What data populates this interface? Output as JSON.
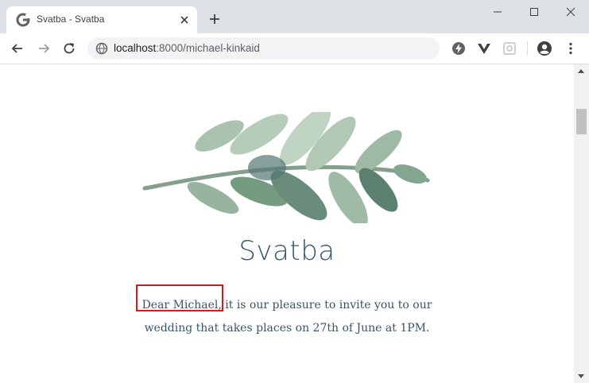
{
  "browser": {
    "tab_title": "Svatba - Svatba",
    "url_host": "localhost",
    "url_rest": ":8000/michael-kinkaid"
  },
  "page": {
    "title": "Svatba",
    "greeting": "Dear Michael,",
    "message_line1": " it is our pleasure to invite you to our",
    "message_line2": "wedding that takes places on 27th of June at 1PM."
  },
  "colors": {
    "accent_text": "#385566",
    "highlight": "#e0141a",
    "leaf_green": "#6f9a7c"
  },
  "icons": [
    "google-favicon",
    "close-icon",
    "plus-icon",
    "minimize-icon",
    "maximize-icon",
    "window-close-icon",
    "back-arrow-icon",
    "forward-arrow-icon",
    "reload-icon",
    "site-info-icon",
    "bolt-extension-icon",
    "vue-extension-icon",
    "extension-icon",
    "profile-icon",
    "more-menu-icon",
    "leaf-branch-illustration"
  ]
}
